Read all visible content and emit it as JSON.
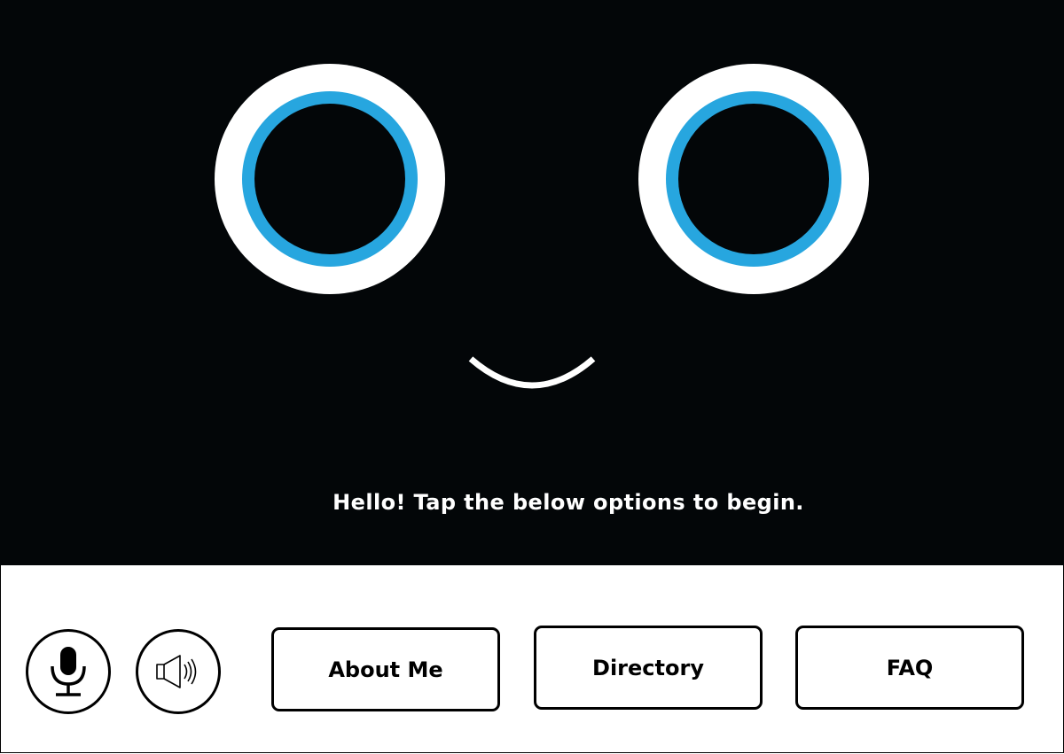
{
  "face": {
    "greeting": "Hello! Tap the below options to begin.",
    "colors": {
      "background": "#030608",
      "sclera": "#ffffff",
      "iris": "#27a6df",
      "mouth": "#ffffff"
    }
  },
  "controls": {
    "mic_icon": "microphone-icon",
    "speaker_icon": "speaker-icon"
  },
  "menu": {
    "about_label": "About Me",
    "directory_label": "Directory",
    "faq_label": "FAQ"
  }
}
